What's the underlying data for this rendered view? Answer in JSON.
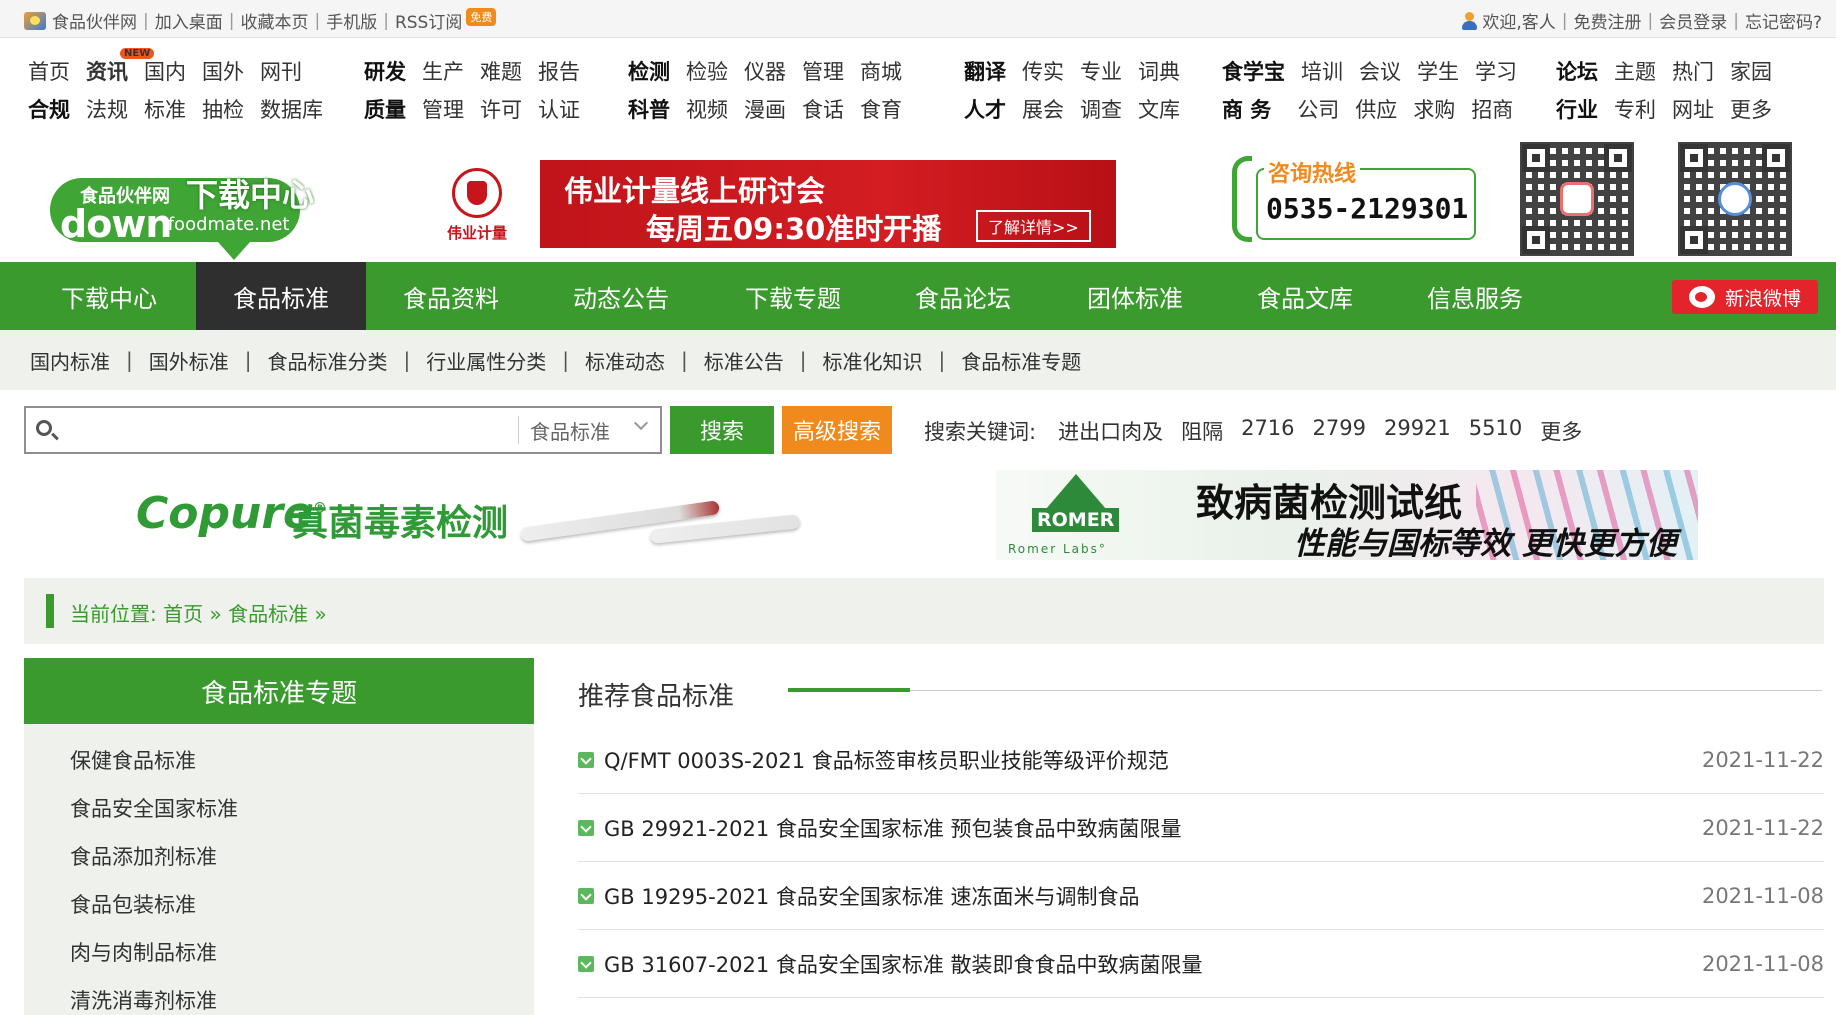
{
  "topbar": {
    "site": "食品伙伴网",
    "links": [
      "加入桌面",
      "收藏本页",
      "手机版",
      "RSS订阅"
    ],
    "free_badge": "免费",
    "welcome": "欢迎,客人",
    "register": "免费注册",
    "login": "会员登录",
    "forgot": "忘记密码?"
  },
  "catnav": {
    "new_badge": "NEW",
    "groups": [
      {
        "row1": [
          "首页",
          "资讯",
          "国内",
          "国外",
          "网刊"
        ],
        "row2": [
          "合规",
          "法规",
          "标准",
          "抽检",
          "数据库"
        ]
      },
      {
        "row1": [
          "研发",
          "生产",
          "难题",
          "报告"
        ],
        "row2": [
          "质量",
          "管理",
          "许可",
          "认证"
        ]
      },
      {
        "row1": [
          "检测",
          "检验",
          "仪器",
          "管理",
          "商城"
        ],
        "row2": [
          "科普",
          "视频",
          "漫画",
          "食话",
          "食育"
        ]
      },
      {
        "row1": [
          "翻译",
          "传实",
          "专业",
          "词典"
        ],
        "row2": [
          "人才",
          "展会",
          "调查",
          "文库"
        ]
      },
      {
        "row1": [
          "食学宝",
          "培训",
          "会议",
          "学生",
          "学习"
        ],
        "row2": [
          "商 务",
          "公司",
          "供应",
          "求购",
          "招商"
        ]
      },
      {
        "row1": [
          "论坛",
          "主题",
          "热门",
          "家园"
        ],
        "row2": [
          "行业",
          "专利",
          "网址",
          "更多"
        ]
      }
    ]
  },
  "logo": {
    "tag": "食品伙伴网",
    "big": "下载中心",
    "down": "down",
    "domain": ".foodmate.net"
  },
  "weiye": {
    "name": "伟业计量",
    "banner_line1": "伟业计量线上研讨会",
    "banner_line2": "每周五09:30准时开播",
    "banner_btn": "了解详情>>"
  },
  "hotline": {
    "title": "咨询热线",
    "number": "0535-2129301"
  },
  "mainnav": {
    "items": [
      "下载中心",
      "食品标准",
      "食品资料",
      "动态公告",
      "下载专题",
      "食品论坛",
      "团体标准",
      "食品文库",
      "信息服务"
    ],
    "active_index": 1,
    "weibo": "新浪微博"
  },
  "subnav": [
    "国内标准",
    "国外标准",
    "食品标准分类",
    "行业属性分类",
    "标准动态",
    "标准公告",
    "标准化知识",
    "食品标准专题"
  ],
  "search": {
    "value": "",
    "placeholder": "",
    "category": "食品标准",
    "search_btn": "搜索",
    "adv_btn": "高级搜索",
    "keywords_label": "搜索关键词:",
    "keywords": [
      "进出口肉及",
      "阻隔",
      "2716",
      "2799",
      "29921",
      "5510",
      "更多"
    ]
  },
  "ads": {
    "copure_brand": "Copure",
    "copure_reg": "®",
    "copure_text": "真菌毒素检测",
    "romer_brand": "ROMER",
    "romer_sub": "Romer Labs°",
    "romer_t1": "致病菌检测试纸",
    "romer_t2": "性能与国标等效 更快更方便"
  },
  "breadcrumb": {
    "label": "当前位置:",
    "home": "首页",
    "current": "食品标准",
    "sep": "»"
  },
  "sidebar": {
    "title": "食品标准专题",
    "items": [
      "保健食品标准",
      "食品安全国家标准",
      "食品添加剂标准",
      "食品包装标准",
      "肉与肉制品标准",
      "清洗消毒剂标准"
    ]
  },
  "recommended": {
    "title": "推荐食品标准",
    "items": [
      {
        "title": "Q/FMT 0003S-2021 食品标签审核员职业技能等级评价规范",
        "date": "2021-11-22"
      },
      {
        "title": "GB 29921-2021 食品安全国家标准 预包装食品中致病菌限量",
        "date": "2021-11-22"
      },
      {
        "title": "GB 19295-2021 食品安全国家标准 速冻面米与调制食品",
        "date": "2021-11-08"
      },
      {
        "title": "GB 31607-2021 食品安全国家标准 散装即食食品中致病菌限量",
        "date": "2021-11-08"
      }
    ]
  },
  "colors": {
    "brand_green": "#3a9a2e",
    "nav_active": "#2f2f2f",
    "accent_orange": "#f08a1c",
    "weiye_red": "#c8151b"
  }
}
